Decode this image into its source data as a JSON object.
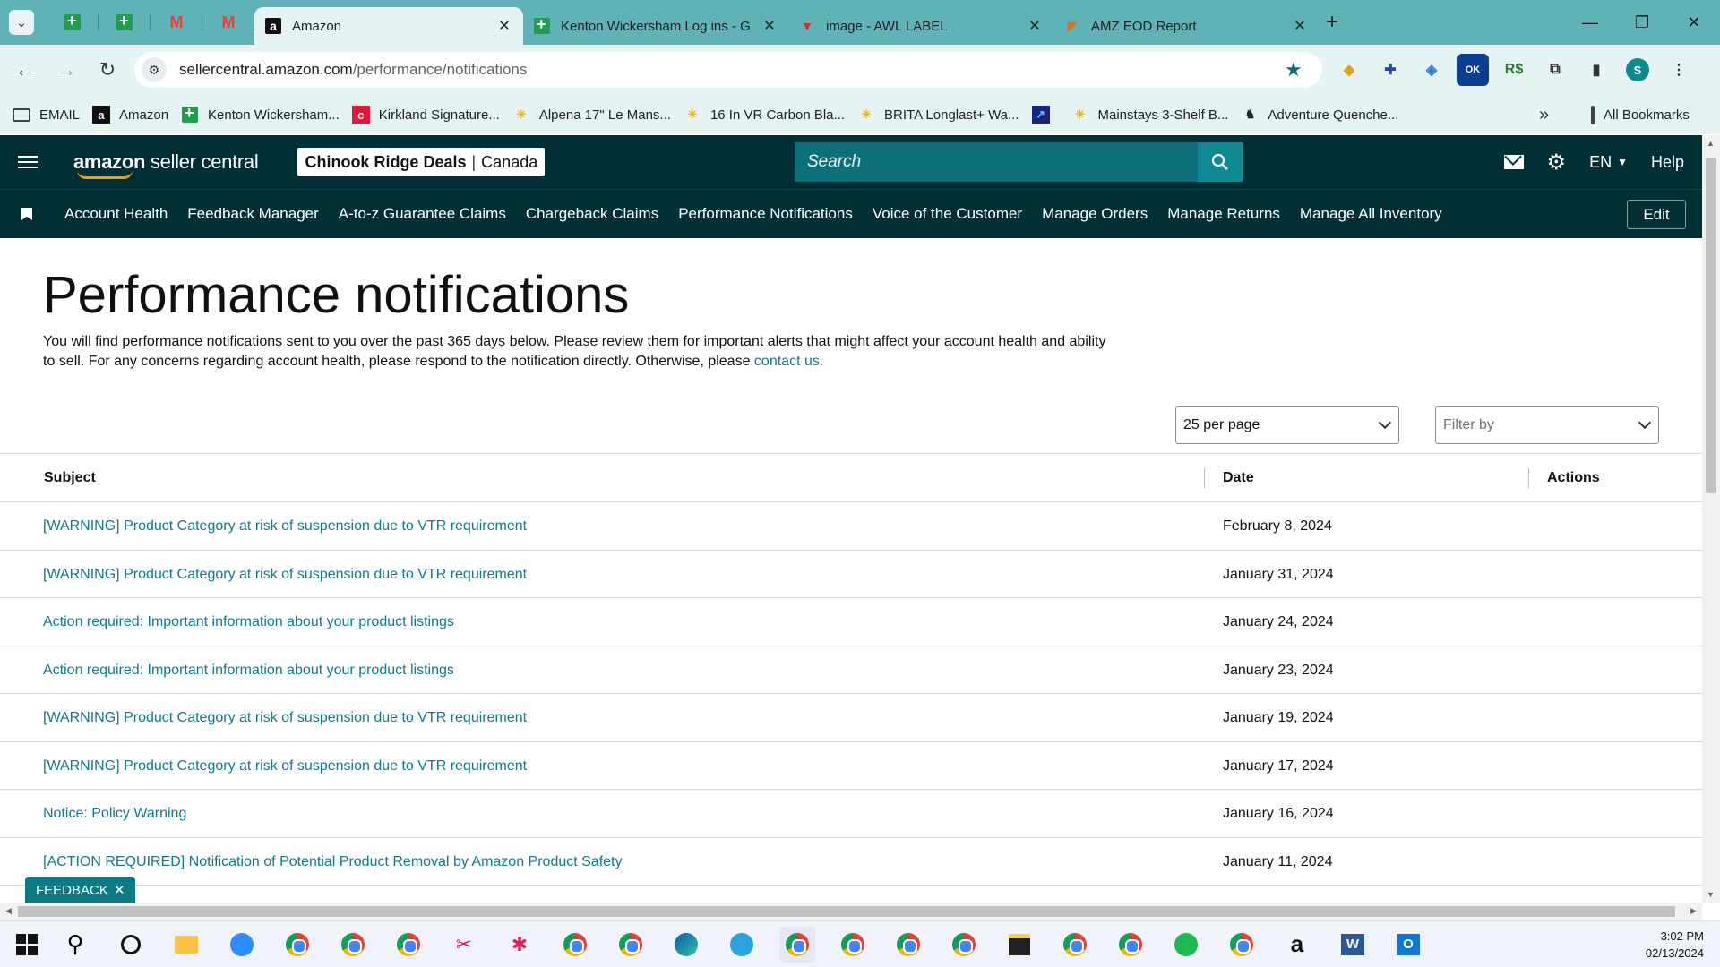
{
  "browser": {
    "tabs": [
      {
        "label": "Amazon",
        "active": true,
        "icon": "amazon-icon"
      },
      {
        "label": "Kenton Wickersham Log ins - G",
        "active": false,
        "icon": "google-sheets-icon"
      },
      {
        "label": "image - AWL LABEL",
        "active": false,
        "icon": "awl-icon"
      },
      {
        "label": "AMZ EOD Report",
        "active": false,
        "icon": "report-icon"
      }
    ],
    "url_host": "sellercentral.amazon.com",
    "url_path": "/performance/notifications",
    "profile_initial": "S",
    "bookmarks": [
      {
        "label": "EMAIL",
        "icon": "folder-icon"
      },
      {
        "label": "Amazon",
        "icon": "amazon-icon"
      },
      {
        "label": "Kenton Wickersham...",
        "icon": "google-sheets-icon"
      },
      {
        "label": "Kirkland Signature...",
        "icon": "costco-icon"
      },
      {
        "label": "Alpena 17\" Le Mans...",
        "icon": "walmart-icon"
      },
      {
        "label": "16 In VR Carbon Bla...",
        "icon": "walmart-icon"
      },
      {
        "label": "BRITA Longlast+ Wa...",
        "icon": "walmart-icon"
      },
      {
        "label": "",
        "icon": "chart-icon"
      },
      {
        "label": "Mainstays 3-Shelf B...",
        "icon": "walmart-icon"
      },
      {
        "label": "Adventure Quenche...",
        "icon": "stanley-icon"
      }
    ],
    "all_bookmarks_label": "All Bookmarks"
  },
  "header": {
    "logo_bold": "amazon",
    "logo_light": " seller central",
    "store_name": "Chinook Ridge Deals",
    "store_region": "Canada",
    "search_placeholder": "Search",
    "language": "EN",
    "help_label": "Help"
  },
  "nav": {
    "links": [
      "Account Health",
      "Feedback Manager",
      "A-to-z Guarantee Claims",
      "Chargeback Claims",
      "Performance Notifications",
      "Voice of the Customer",
      "Manage Orders",
      "Manage Returns",
      "Manage All Inventory"
    ],
    "edit_label": "Edit"
  },
  "page": {
    "title": "Performance notifications",
    "intro_text": "You will find performance notifications sent to you over the past 365 days below. Please review them for important alerts that might affect your account health and ability to sell. For any concerns regarding account health, please respond to the notification directly. Otherwise, please ",
    "contact_link": "contact us.",
    "per_page": "25 per page",
    "filter_placeholder": "Filter by"
  },
  "table": {
    "headers": {
      "subject": "Subject",
      "date": "Date",
      "actions": "Actions"
    },
    "rows": [
      {
        "subject": "[WARNING] Product Category at risk of suspension due to VTR requirement",
        "date": "February 8, 2024"
      },
      {
        "subject": "[WARNING] Product Category at risk of suspension due to VTR requirement",
        "date": "January 31, 2024"
      },
      {
        "subject": "Action required: Important information about your product listings",
        "date": "January 24, 2024"
      },
      {
        "subject": "Action required: Important information about your product listings",
        "date": "January 23, 2024"
      },
      {
        "subject": "[WARNING] Product Category at risk of suspension due to VTR requirement",
        "date": "January 19, 2024"
      },
      {
        "subject": "[WARNING] Product Category at risk of suspension due to VTR requirement",
        "date": "January 17, 2024"
      },
      {
        "subject": "Notice: Policy Warning",
        "date": "January 16, 2024"
      },
      {
        "subject": "[ACTION REQUIRED] Notification of Potential Product Removal by Amazon Product Safety",
        "date": "January 11, 2024"
      }
    ]
  },
  "feedback_label": "FEEDBACK",
  "taskbar": {
    "time": "3:02 PM",
    "date": "02/13/2024"
  },
  "colors": {
    "header_bg": "#002f36",
    "link": "#0d7b8a",
    "tab_strip": "#5fb3b7"
  }
}
